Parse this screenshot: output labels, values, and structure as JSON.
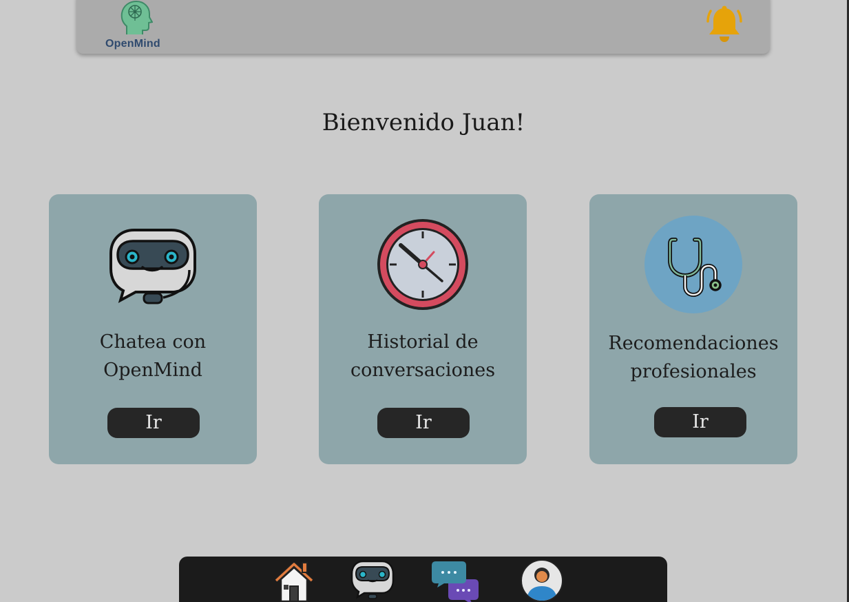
{
  "header": {
    "logo_text": "OpenMind",
    "icons": [
      "brain-head-logo-icon",
      "bell-icon"
    ]
  },
  "welcome": {
    "title": "Bienvenido Juan!"
  },
  "cards": [
    {
      "icon": "robot-chat-icon",
      "title_line1": "Chatea con",
      "title_line2": "OpenMind",
      "button_label": "Ir"
    },
    {
      "icon": "clock-icon",
      "title_line1": "Historial de",
      "title_line2": "conversaciones",
      "button_label": "Ir"
    },
    {
      "icon": "stethoscope-icon",
      "title_line1": "Recomendaciones",
      "title_line2": "profesionales",
      "button_label": "Ir"
    }
  ],
  "bottom_nav": {
    "items": [
      "home-icon",
      "robot-icon",
      "chat-bubbles-icon",
      "user-profile-icon"
    ]
  },
  "colors": {
    "background": "#cbcbcb",
    "header": "#ababab",
    "card": "#8ea6aa",
    "button": "#262626",
    "bell": "#e6a30a",
    "navbar": "#1b1b1b",
    "logo_text": "#2f4a6e"
  }
}
